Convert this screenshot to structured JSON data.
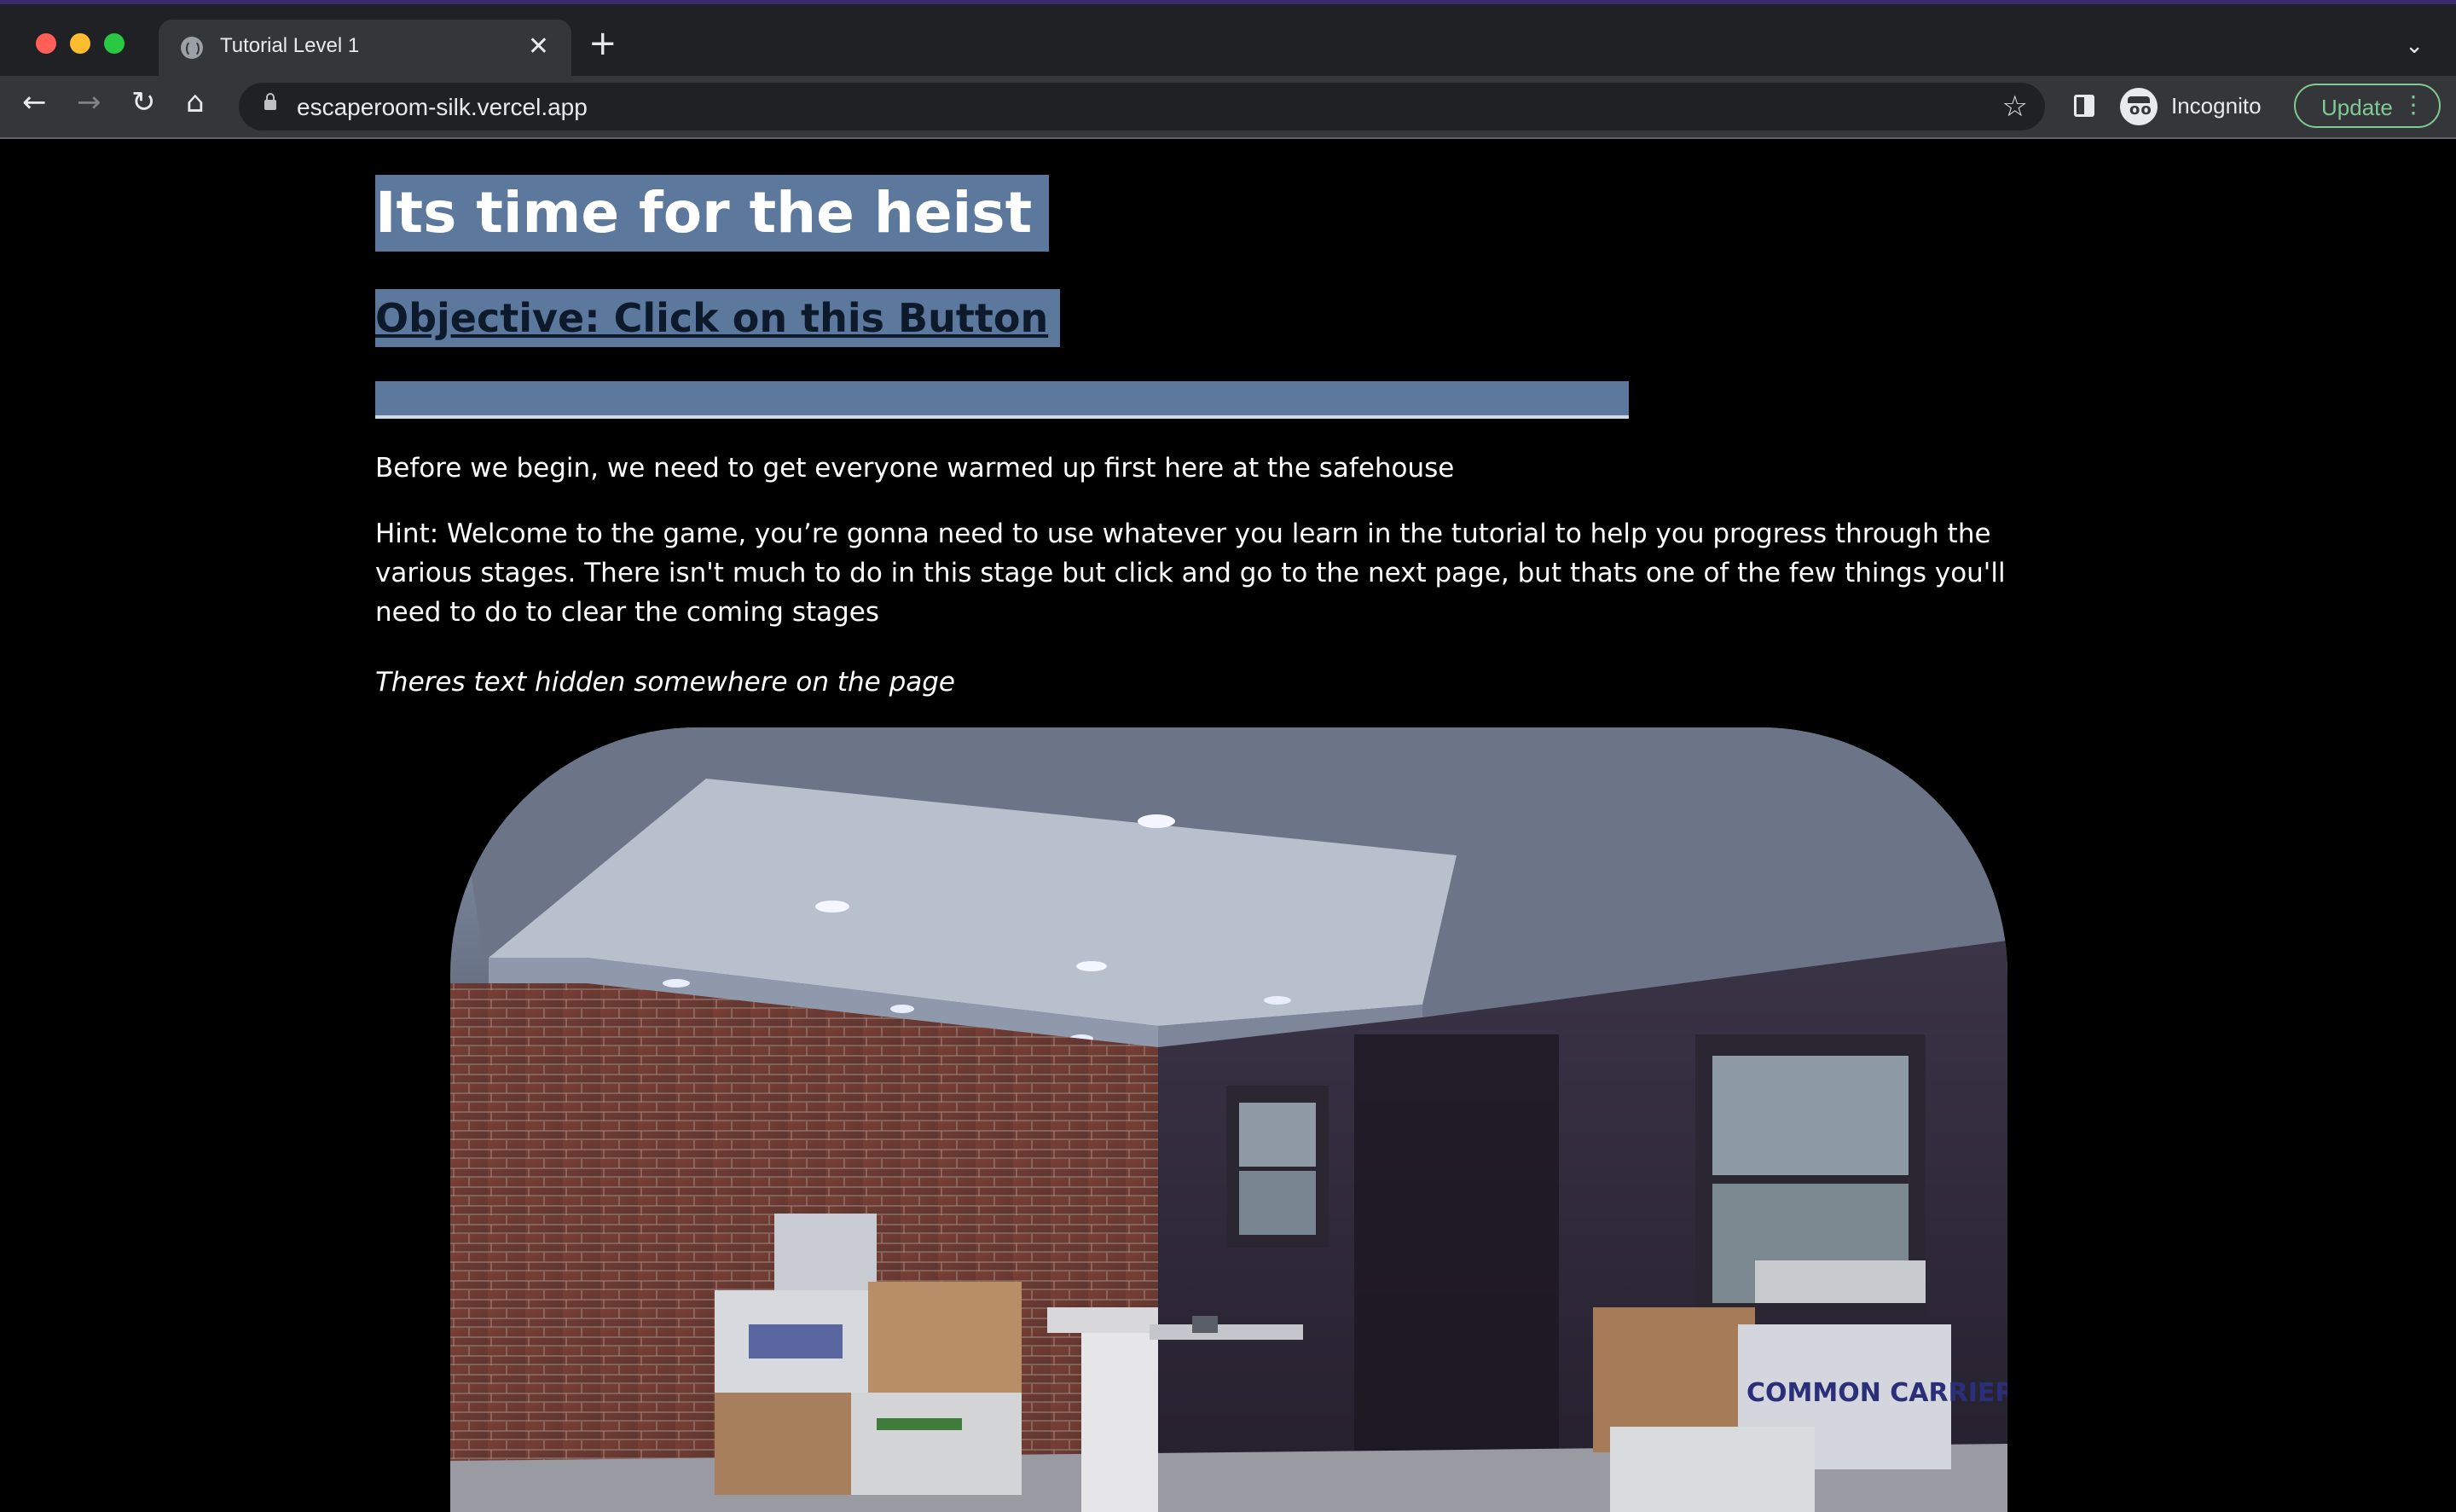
{
  "browser": {
    "tab_title": "Tutorial Level 1",
    "url": "escaperoom-silk.vercel.app",
    "profile_label": "Incognito",
    "update_label": "Update",
    "new_tab_symbol": "+",
    "close_symbol": "✕",
    "icons": {
      "back": "back-arrow-icon",
      "forward": "forward-arrow-icon",
      "reload": "reload-icon",
      "home": "home-icon",
      "lock": "lock-icon",
      "star": "star-icon",
      "side_panel": "side-panel-icon",
      "incognito": "incognito-icon",
      "menu": "kebab-menu-icon",
      "tab_list": "chevron-down-icon"
    }
  },
  "page": {
    "heading": "Its time for the heist",
    "objective_button": "Objective: Click on this Button",
    "intro": "Before we begin, we need to get everyone warmed up first here at the safehouse",
    "hint": "Hint: Welcome to the game, you’re gonna need to use whatever you learn in the tutorial to help you progress through the various stages. There isn't much to do in this stage but click and go to the next page, but thats one of the few things you'll need to do to clear the coming stages",
    "hidden_text_note": "Theres text hidden somewhere on the page",
    "image_subject": "safehouse room with brick wall, windows, cardboard boxes and a folding chair",
    "box_label": "COMMON CARRIERS",
    "accent_color": "#5d789d"
  }
}
